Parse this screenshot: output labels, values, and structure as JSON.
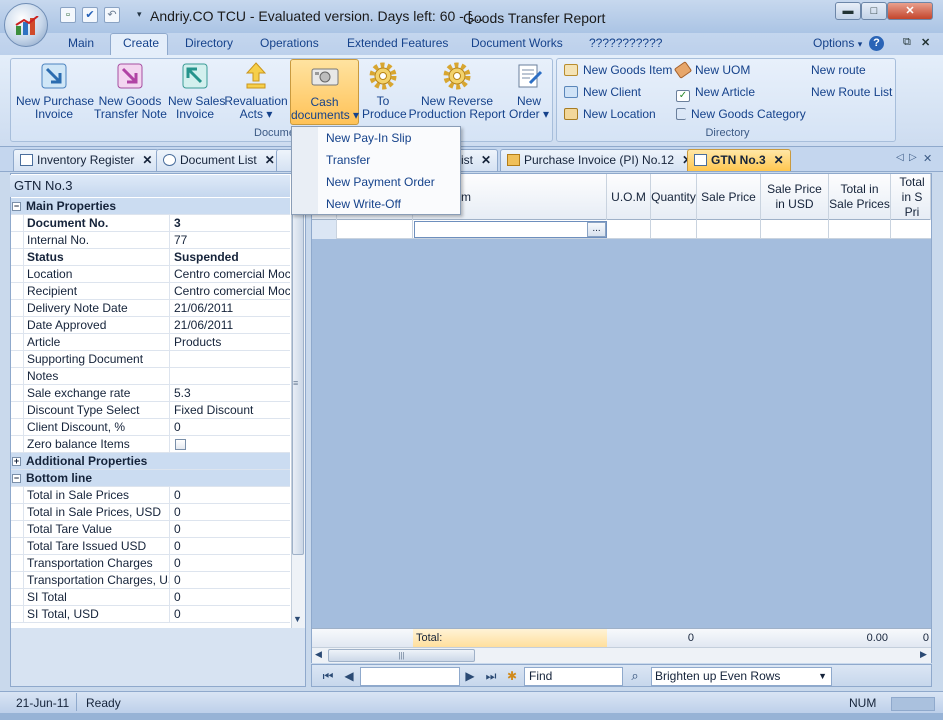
{
  "window": {
    "title": "Andriy.CO TCU - Evaluated version. Days left: 60 - [...",
    "title_right": "Goods Transfer Report",
    "min": "▬",
    "max": "□",
    "close": "✕"
  },
  "menu": {
    "tabs": [
      "Main",
      "Create",
      "Directory",
      "Operations",
      "Extended Features",
      "Document Works",
      "???????????"
    ],
    "options": "Options",
    "help": "?",
    "restore": "⧉",
    "close": "✕"
  },
  "ribbon": {
    "documents_group_label": "Documents",
    "directory_group_label": "Directory",
    "buttons": {
      "new_purchase_invoice": [
        "New Purchase",
        "Invoice"
      ],
      "new_goods_transfer_note": [
        "New Goods",
        "Transfer Note"
      ],
      "new_sales_invoice": [
        "New Sales",
        "Invoice"
      ],
      "revaluation_acts": [
        "Revaluation",
        "Acts ▾"
      ],
      "cash_documents": [
        "Cash",
        "documents ▾"
      ],
      "to_produce": [
        "To",
        "Produce"
      ],
      "new_reverse_production_report": [
        "New Reverse",
        "Production Report"
      ],
      "new_order": [
        "New",
        "Order ▾"
      ]
    },
    "directory_items": {
      "new_goods_item": "New Goods Item",
      "new_uom": "New UOM",
      "new_route": "New route",
      "new_client": "New Client",
      "new_article": "New Article",
      "new_route_list": "New Route List",
      "new_location": "New Location",
      "new_goods_category": "New Goods Category"
    }
  },
  "cash_menu": [
    "New Pay-In Slip",
    "Transfer",
    "New Payment Order",
    "New Write-Off"
  ],
  "doc_tabs": {
    "inventory_register": "Inventory Register",
    "document_list": "Document List",
    "list_partial": "ist",
    "purchase_invoice": "Purchase Invoice (PI) No.12",
    "gtn": "GTN No.3",
    "close_glyph": "✕",
    "nav_left": "◁",
    "nav_right": "▷",
    "nav_close": "✕"
  },
  "properties": {
    "header": "GTN No.3",
    "main_section": "Main Properties",
    "rows": [
      {
        "label": "Document No.",
        "value": "3"
      },
      {
        "label": "Internal No.",
        "value": "77"
      },
      {
        "label": "Status",
        "value": "Suspended"
      },
      {
        "label": "Location",
        "value": "Centro comercial Moctezuma"
      },
      {
        "label": "Recipient",
        "value": "Centro comercial Moctezuma"
      },
      {
        "label": "Delivery Note Date",
        "value": "21/06/2011"
      },
      {
        "label": "Date Approved",
        "value": "21/06/2011"
      },
      {
        "label": "Article",
        "value": "Products"
      },
      {
        "label": "Supporting Document",
        "value": ""
      },
      {
        "label": "Notes",
        "value": ""
      },
      {
        "label": "Sale exchange rate",
        "value": "5.3"
      },
      {
        "label": "Discount Type Select",
        "value": "Fixed Discount"
      },
      {
        "label": "Client Discount, %",
        "value": "0"
      },
      {
        "label": "Zero balance Items",
        "value": ""
      }
    ],
    "additional_section": "Additional Properties",
    "bottom_section": "Bottom line",
    "bottom_rows": [
      {
        "label": "Total in Sale Prices",
        "value": "0"
      },
      {
        "label": "Total in Sale Prices, USD",
        "value": "0"
      },
      {
        "label": "Total Tare Value",
        "value": "0"
      },
      {
        "label": "Total Tare Issued USD",
        "value": "0"
      },
      {
        "label": "Transportation Charges",
        "value": "0"
      },
      {
        "label": "Transportation Charges, USD",
        "value": "0"
      },
      {
        "label": "SI Total",
        "value": "0"
      },
      {
        "label": "SI Total, USD",
        "value": "0"
      }
    ]
  },
  "grid": {
    "columns": [
      "m",
      "U.O.M",
      "Quantity",
      "Sale Price",
      "Sale Price in USD",
      "Total in Sale Prices",
      "Total in S Pri"
    ],
    "item_button": "...",
    "total_label": "Total:",
    "total_quantity": "0",
    "total_sale_prices": "0.00",
    "total_last": "0"
  },
  "navigator": {
    "first": "⏮",
    "prev": "◀",
    "next": "▶",
    "last": "⏭",
    "find_value": "Find",
    "row_style": "Brighten up Even Rows"
  },
  "status": {
    "date": "21-Jun-11",
    "state": "Ready",
    "num": "NUM"
  },
  "colors": {
    "accent": "#ffc64f",
    "ribbon_text": "#15428b",
    "grid_bg": "#a4bddd"
  }
}
